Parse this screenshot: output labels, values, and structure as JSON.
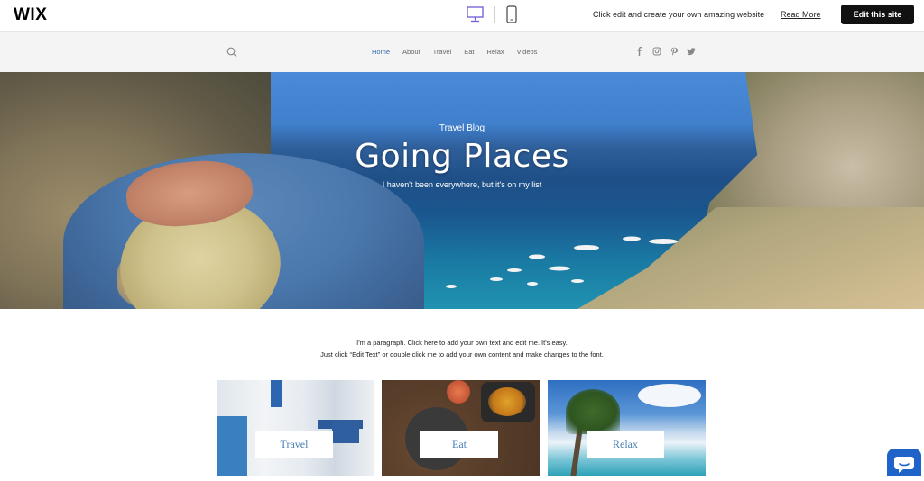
{
  "wix_bar": {
    "logo": "WIX",
    "desktop_icon": "desktop-monitor-icon",
    "mobile_icon": "mobile-phone-icon",
    "message": "Click edit and create your own amazing website",
    "read_more": "Read More",
    "edit_button": "Edit this site",
    "accent_color": "#6f5bd6"
  },
  "nav": {
    "search_icon": "search-icon",
    "items": [
      {
        "label": "Home",
        "active": true
      },
      {
        "label": "About",
        "active": false
      },
      {
        "label": "Travel",
        "active": false
      },
      {
        "label": "Eat",
        "active": false
      },
      {
        "label": "Relax",
        "active": false
      },
      {
        "label": "Videos",
        "active": false
      }
    ],
    "social_icons": [
      "facebook-icon",
      "instagram-icon",
      "pinterest-icon",
      "twitter-icon"
    ],
    "active_color": "#3a6fb0"
  },
  "hero": {
    "subtitle": "Travel Blog",
    "title": "Going Places",
    "tagline": "I haven't been everywhere, but it's on my list"
  },
  "intro": {
    "line1": "I'm a paragraph. Click here to add your own text and edit me. It's easy.",
    "line2": "Just click “Edit Text” or double click me to add your own content and make changes to the font."
  },
  "cards": [
    {
      "label": "Travel"
    },
    {
      "label": "Eat"
    },
    {
      "label": "Relax"
    }
  ],
  "chat": {
    "icon": "chat-bubble-icon",
    "color": "#1f63c9"
  }
}
